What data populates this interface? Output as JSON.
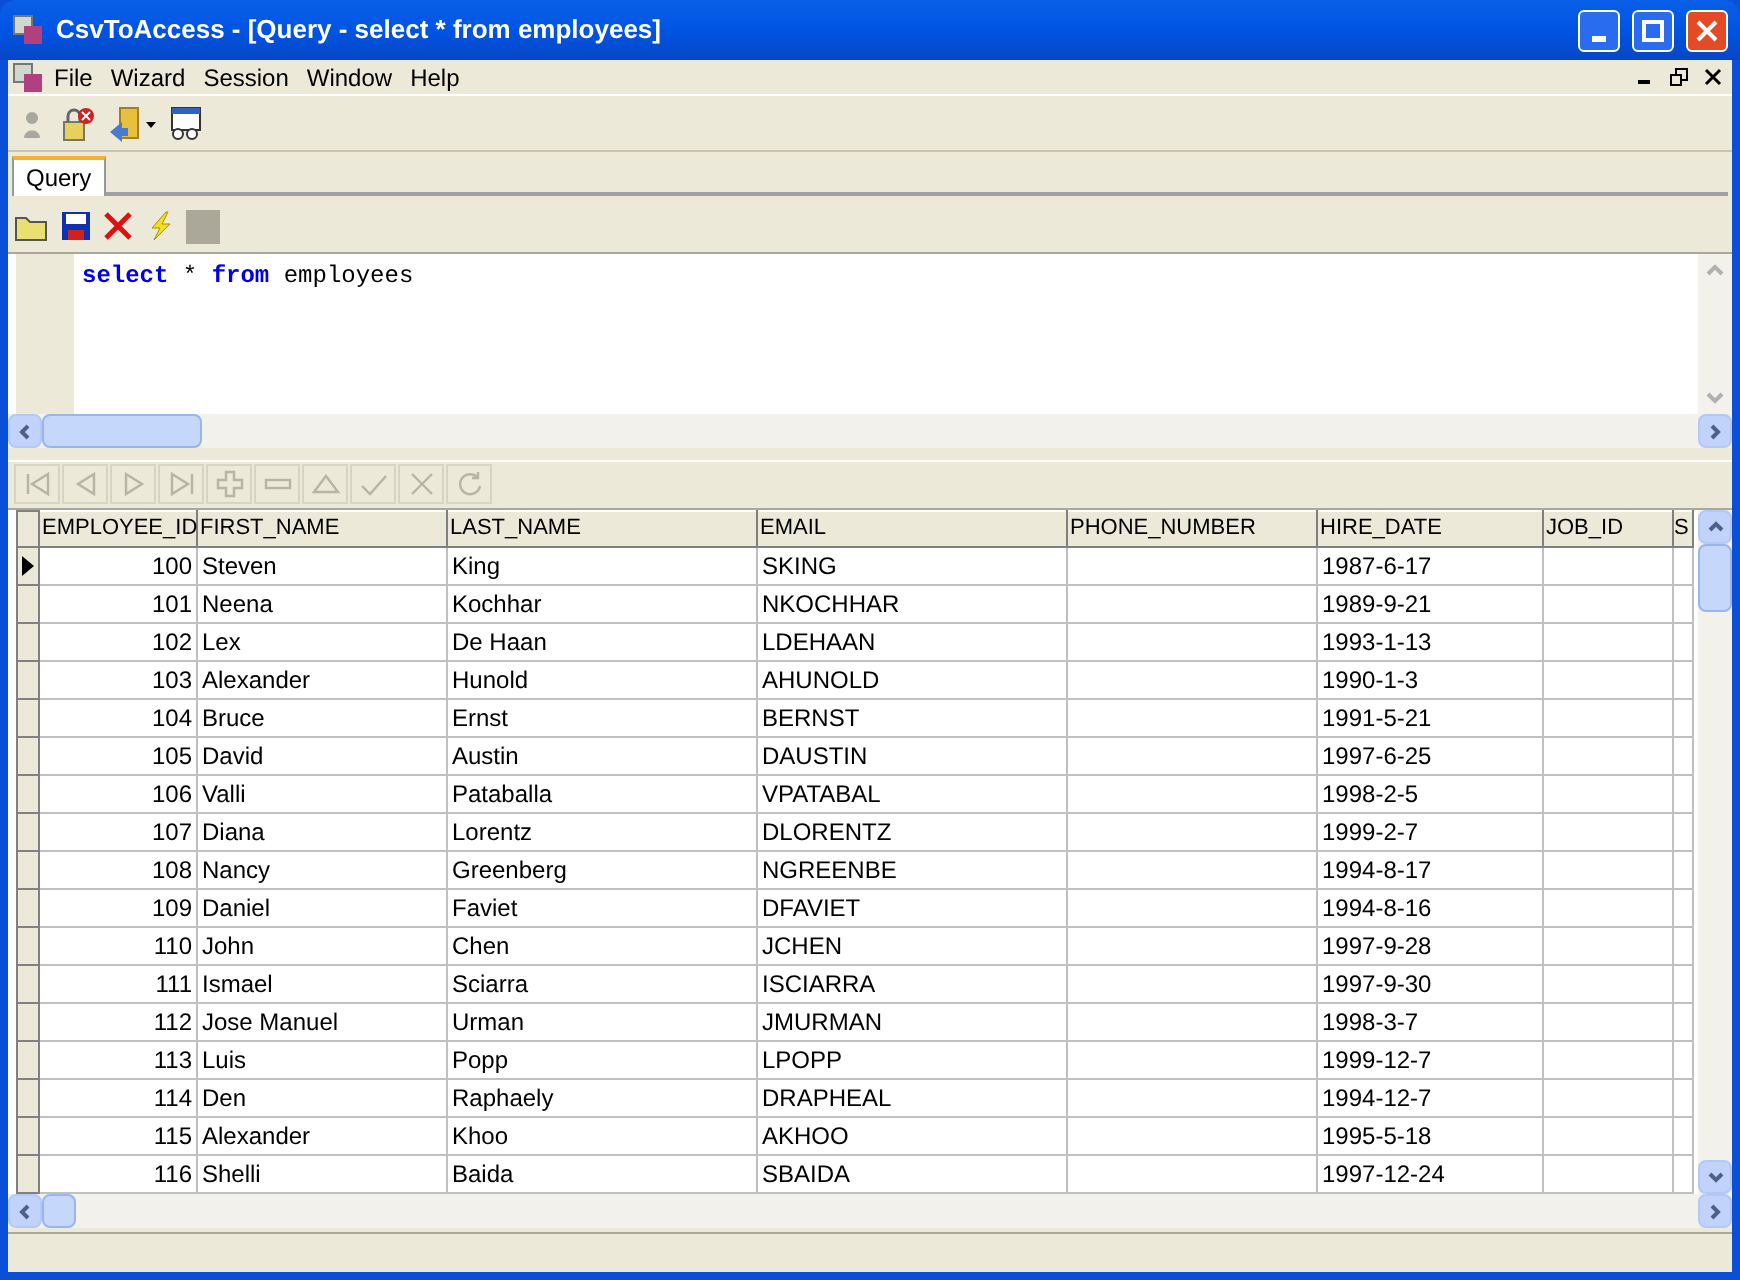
{
  "window": {
    "title": "CsvToAccess - [Query - select * from employees]"
  },
  "menu": [
    "File",
    "Wizard",
    "Session",
    "Window",
    "Help"
  ],
  "tabs": [
    {
      "label": "Query",
      "selected": true
    }
  ],
  "editor": {
    "sql": [
      {
        "kind": "keyword",
        "text": "select"
      },
      {
        "kind": "plain",
        "text": " * "
      },
      {
        "kind": "keyword",
        "text": "from"
      },
      {
        "kind": "plain",
        "text": " employees"
      }
    ]
  },
  "navigator": [
    {
      "kind": "first",
      "disabled": true
    },
    {
      "kind": "prior",
      "disabled": true
    },
    {
      "kind": "next",
      "disabled": true
    },
    {
      "kind": "last",
      "disabled": true
    },
    {
      "kind": "insert",
      "disabled": true
    },
    {
      "kind": "delete",
      "disabled": true
    },
    {
      "kind": "edit",
      "disabled": true
    },
    {
      "kind": "post",
      "disabled": true
    },
    {
      "kind": "cancel",
      "disabled": true
    },
    {
      "kind": "refresh",
      "disabled": true
    }
  ],
  "table": {
    "columns": [
      "EMPLOYEE_ID",
      "FIRST_NAME",
      "LAST_NAME",
      "EMAIL",
      "PHONE_NUMBER",
      "HIRE_DATE",
      "JOB_ID",
      "S"
    ],
    "rows": [
      {
        "selected": true,
        "employee_id": "100",
        "first_name": "Steven",
        "last_name": "King",
        "email": "SKING",
        "hire_date": "1987-6-17"
      },
      {
        "selected": false,
        "employee_id": "101",
        "first_name": "Neena",
        "last_name": "Kochhar",
        "email": "NKOCHHAR",
        "hire_date": "1989-9-21"
      },
      {
        "selected": false,
        "employee_id": "102",
        "first_name": "Lex",
        "last_name": "De Haan",
        "email": "LDEHAAN",
        "hire_date": "1993-1-13"
      },
      {
        "selected": false,
        "employee_id": "103",
        "first_name": "Alexander",
        "last_name": "Hunold",
        "email": "AHUNOLD",
        "hire_date": "1990-1-3"
      },
      {
        "selected": false,
        "employee_id": "104",
        "first_name": "Bruce",
        "last_name": "Ernst",
        "email": "BERNST",
        "hire_date": "1991-5-21"
      },
      {
        "selected": false,
        "employee_id": "105",
        "first_name": "David",
        "last_name": "Austin",
        "email": "DAUSTIN",
        "hire_date": "1997-6-25"
      },
      {
        "selected": false,
        "employee_id": "106",
        "first_name": "Valli",
        "last_name": "Pataballa",
        "email": "VPATABAL",
        "hire_date": "1998-2-5"
      },
      {
        "selected": false,
        "employee_id": "107",
        "first_name": "Diana",
        "last_name": "Lorentz",
        "email": "DLORENTZ",
        "hire_date": "1999-2-7"
      },
      {
        "selected": false,
        "employee_id": "108",
        "first_name": "Nancy",
        "last_name": "Greenberg",
        "email": "NGREENBE",
        "hire_date": "1994-8-17"
      },
      {
        "selected": false,
        "employee_id": "109",
        "first_name": "Daniel",
        "last_name": "Faviet",
        "email": "DFAVIET",
        "hire_date": "1994-8-16"
      },
      {
        "selected": false,
        "employee_id": "110",
        "first_name": "John",
        "last_name": "Chen",
        "email": "JCHEN",
        "hire_date": "1997-9-28"
      },
      {
        "selected": false,
        "employee_id": "111",
        "first_name": "Ismael",
        "last_name": "Sciarra",
        "email": "ISCIARRA",
        "hire_date": "1997-9-30"
      },
      {
        "selected": false,
        "employee_id": "112",
        "first_name": "Jose Manuel",
        "last_name": "Urman",
        "email": "JMURMAN",
        "hire_date": "1998-3-7"
      },
      {
        "selected": false,
        "employee_id": "113",
        "first_name": "Luis",
        "last_name": "Popp",
        "email": "LPOPP",
        "hire_date": "1999-12-7"
      },
      {
        "selected": false,
        "employee_id": "114",
        "first_name": "Den",
        "last_name": "Raphaely",
        "email": "DRAPHEAL",
        "hire_date": "1994-12-7"
      },
      {
        "selected": false,
        "employee_id": "115",
        "first_name": "Alexander",
        "last_name": "Khoo",
        "email": "AKHOO",
        "hire_date": "1995-5-18"
      },
      {
        "selected": false,
        "employee_id": "116",
        "first_name": "Shelli",
        "last_name": "Baida",
        "email": "SBAIDA",
        "hire_date": "1997-12-24"
      }
    ]
  }
}
